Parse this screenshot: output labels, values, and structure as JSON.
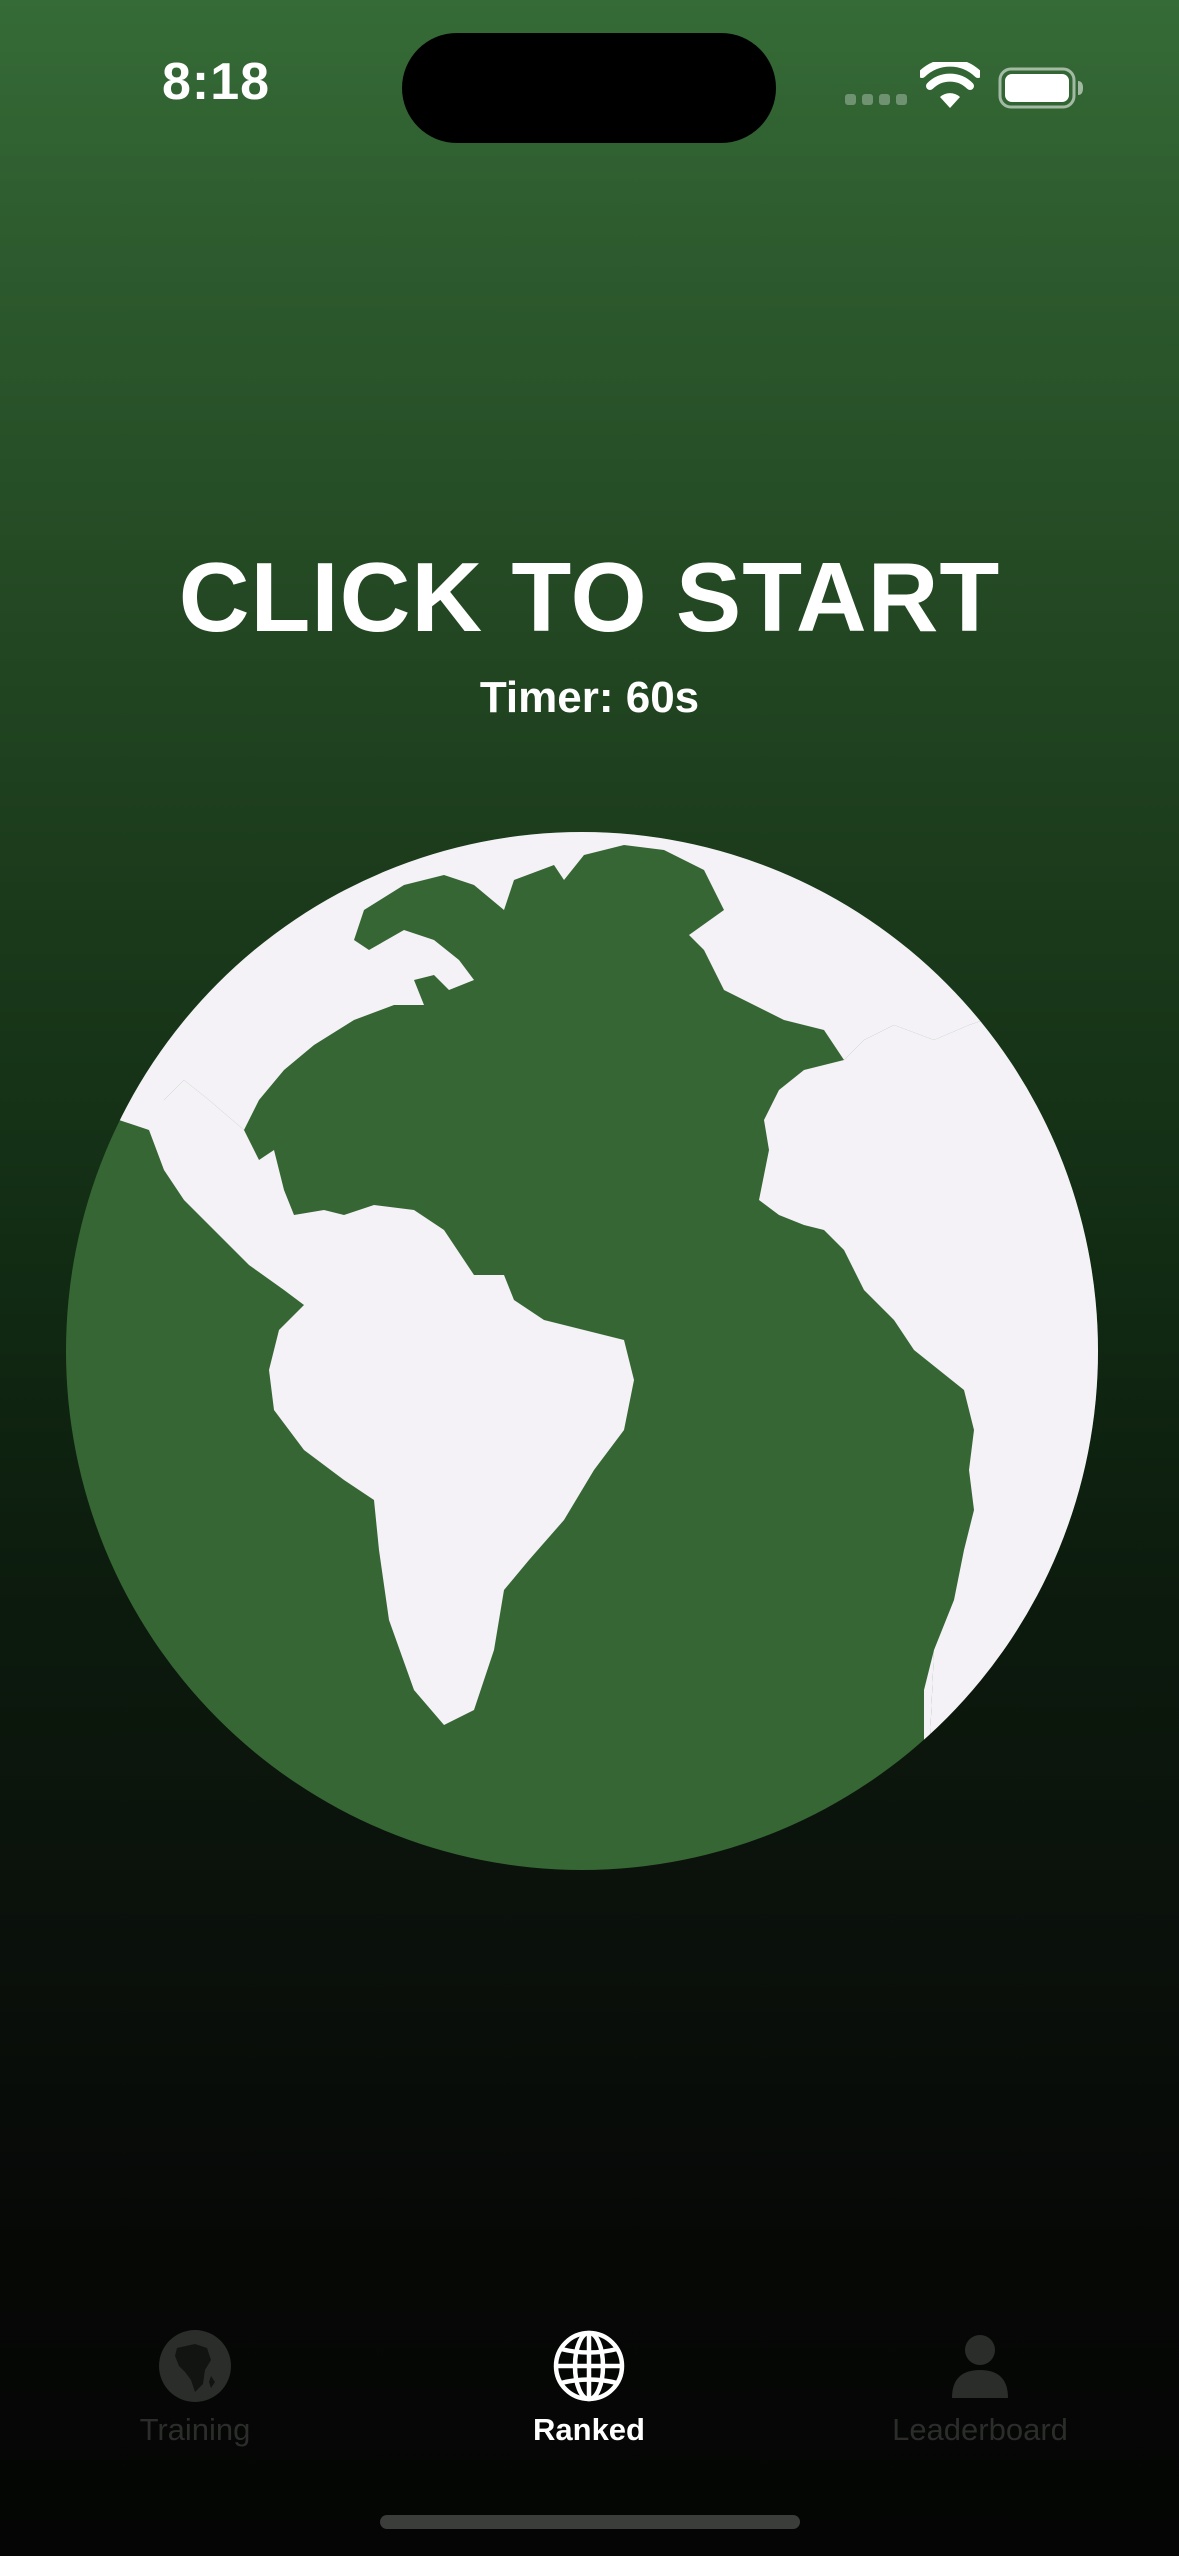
{
  "status_bar": {
    "time": "8:18"
  },
  "main": {
    "title": "CLICK TO START",
    "timer": "Timer: 60s"
  },
  "tabs": [
    {
      "label": "Training",
      "icon": "africa-globe-icon",
      "active": false
    },
    {
      "label": "Ranked",
      "icon": "globe-grid-icon",
      "active": true
    },
    {
      "label": "Leaderboard",
      "icon": "person-icon",
      "active": false
    }
  ],
  "colors": {
    "globe_ocean": "#366634",
    "globe_land": "#f4f2f6",
    "inactive_tab": "#2a2d2a"
  }
}
